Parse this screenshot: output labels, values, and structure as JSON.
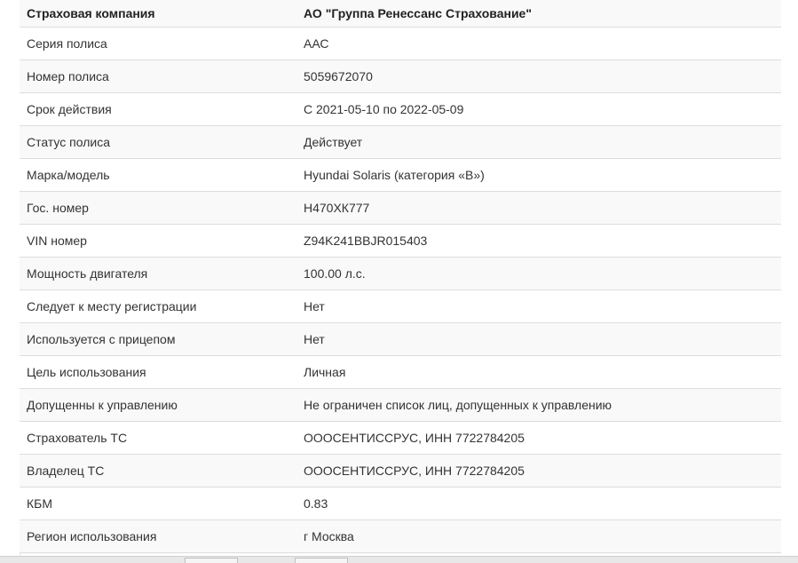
{
  "table": {
    "header": {
      "label": "Страховая компания",
      "value": "АО \"Группа Ренессанс Страхование\""
    },
    "rows": [
      {
        "label": "Серия полиса",
        "value": "ААС"
      },
      {
        "label": "Номер полиса",
        "value": "5059672070"
      },
      {
        "label": "Срок действия",
        "value": "С 2021-05-10 по 2022-05-09"
      },
      {
        "label": "Статус полиса",
        "value": "Действует"
      },
      {
        "label": "Марка/модель",
        "value": "Hyundai Solaris (категория «B»)"
      },
      {
        "label": "Гос. номер",
        "value": "Н470ХК777"
      },
      {
        "label": "VIN номер",
        "value": "Z94K241BBJR015403"
      },
      {
        "label": "Мощность двигателя",
        "value": "100.00 л.с."
      },
      {
        "label": "Следует к месту регистрации",
        "value": "Нет"
      },
      {
        "label": "Используется с прицепом",
        "value": "Нет"
      },
      {
        "label": "Цель использования",
        "value": "Личная"
      },
      {
        "label": "Допущенны к управлению",
        "value": "Не ограничен список лиц, допущенных к управлению"
      },
      {
        "label": "Страхователь ТС",
        "value": "ОООСЕНТИССРУС, ИНН 7722784205"
      },
      {
        "label": "Владелец ТС",
        "value": "ОООСЕНТИССРУС, ИНН 7722784205"
      },
      {
        "label": "КБМ",
        "value": "0.83"
      },
      {
        "label": "Регион использования",
        "value": "г Москва"
      }
    ]
  }
}
